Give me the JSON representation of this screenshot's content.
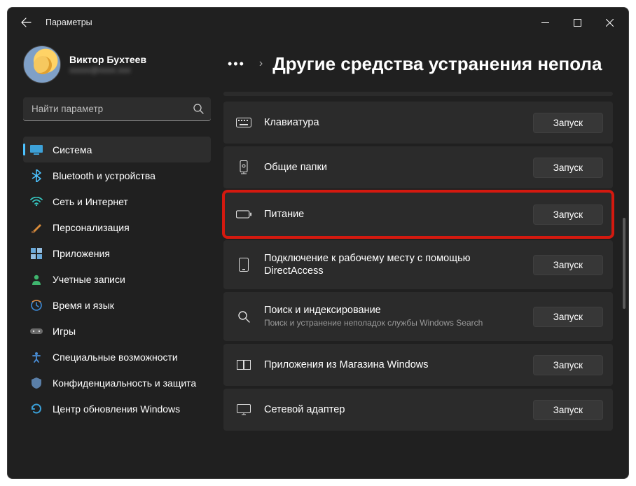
{
  "window": {
    "title": "Параметры"
  },
  "profile": {
    "name": "Виктор Бухтеев",
    "email": "xxxxx@xxxx.xxx"
  },
  "search": {
    "placeholder": "Найти параметр"
  },
  "sidebar": {
    "items": [
      {
        "label": "Система",
        "icon": "monitor",
        "selected": true
      },
      {
        "label": "Bluetooth и устройства",
        "icon": "bluetooth"
      },
      {
        "label": "Сеть и Интернет",
        "icon": "wifi"
      },
      {
        "label": "Персонализация",
        "icon": "brush"
      },
      {
        "label": "Приложения",
        "icon": "apps"
      },
      {
        "label": "Учетные записи",
        "icon": "person"
      },
      {
        "label": "Время и язык",
        "icon": "time"
      },
      {
        "label": "Игры",
        "icon": "games"
      },
      {
        "label": "Специальные возможности",
        "icon": "access"
      },
      {
        "label": "Конфиденциальность и защита",
        "icon": "shield"
      },
      {
        "label": "Центр обновления Windows",
        "icon": "update"
      }
    ]
  },
  "page": {
    "more": "•••",
    "chevron": "›",
    "title": "Другие средства устранения непола"
  },
  "troubleshooters": [
    {
      "title": "Клавиатура",
      "sub": "",
      "icon": "keyboard",
      "run": "Запуск",
      "highlight": false
    },
    {
      "title": "Общие папки",
      "sub": "",
      "icon": "share",
      "run": "Запуск",
      "highlight": false
    },
    {
      "title": "Питание",
      "sub": "",
      "icon": "battery",
      "run": "Запуск",
      "highlight": true
    },
    {
      "title": "Подключение к рабочему месту с помощью DirectAccess",
      "sub": "",
      "icon": "phone",
      "run": "Запуск",
      "highlight": false,
      "tall": true
    },
    {
      "title": "Поиск и индексирование",
      "sub": "Поиск и устранение неполадок службы Windows Search",
      "icon": "search",
      "run": "Запуск",
      "highlight": false,
      "tall": true
    },
    {
      "title": "Приложения из Магазина Windows",
      "sub": "",
      "icon": "store",
      "run": "Запуск",
      "highlight": false
    },
    {
      "title": "Сетевой адаптер",
      "sub": "",
      "icon": "monitor2",
      "run": "Запуск",
      "highlight": false
    }
  ]
}
